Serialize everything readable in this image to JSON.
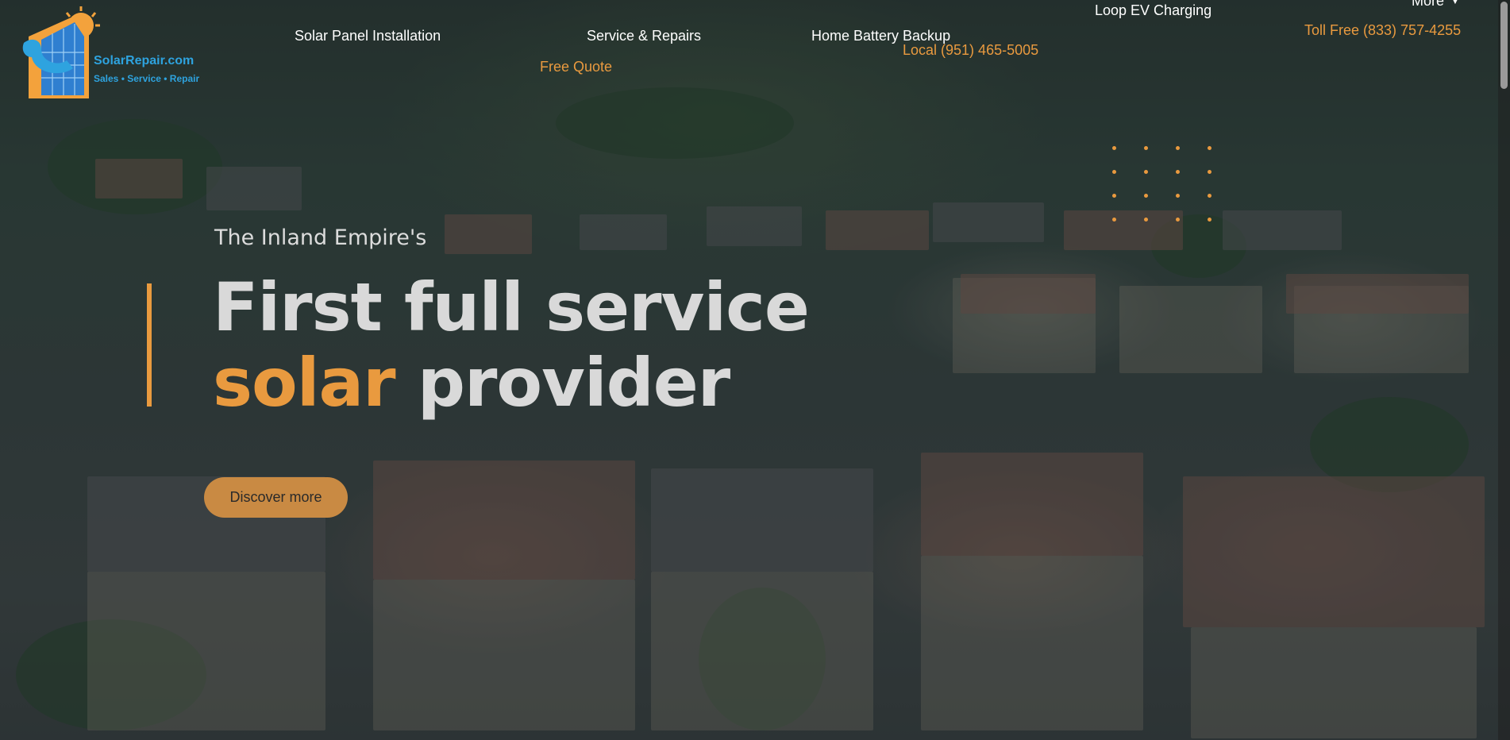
{
  "brand": {
    "name": "SolarRepair.com",
    "tagline": "Sales • Service • Repair"
  },
  "nav": {
    "items": [
      {
        "label": "Solar Panel Installation"
      },
      {
        "label": "Service & Repairs"
      },
      {
        "label": "Home Battery Backup"
      },
      {
        "label": "Loop EV Charging"
      }
    ],
    "more_label": "More",
    "more_icon": "chevron-down-icon",
    "free_quote": "Free Quote",
    "local_phone": "Local (951) 465-5005",
    "toll_free": "Toll Free (833) 757-4255"
  },
  "hero": {
    "subtitle": "The Inland Empire's",
    "headline_line1": "First full service",
    "headline_highlight": "solar",
    "headline_rest": "provider",
    "cta_label": "Discover more"
  },
  "colors": {
    "accent": "#e99a3f",
    "brand_blue": "#2ea3df",
    "text_light": "#d9d9d9"
  }
}
